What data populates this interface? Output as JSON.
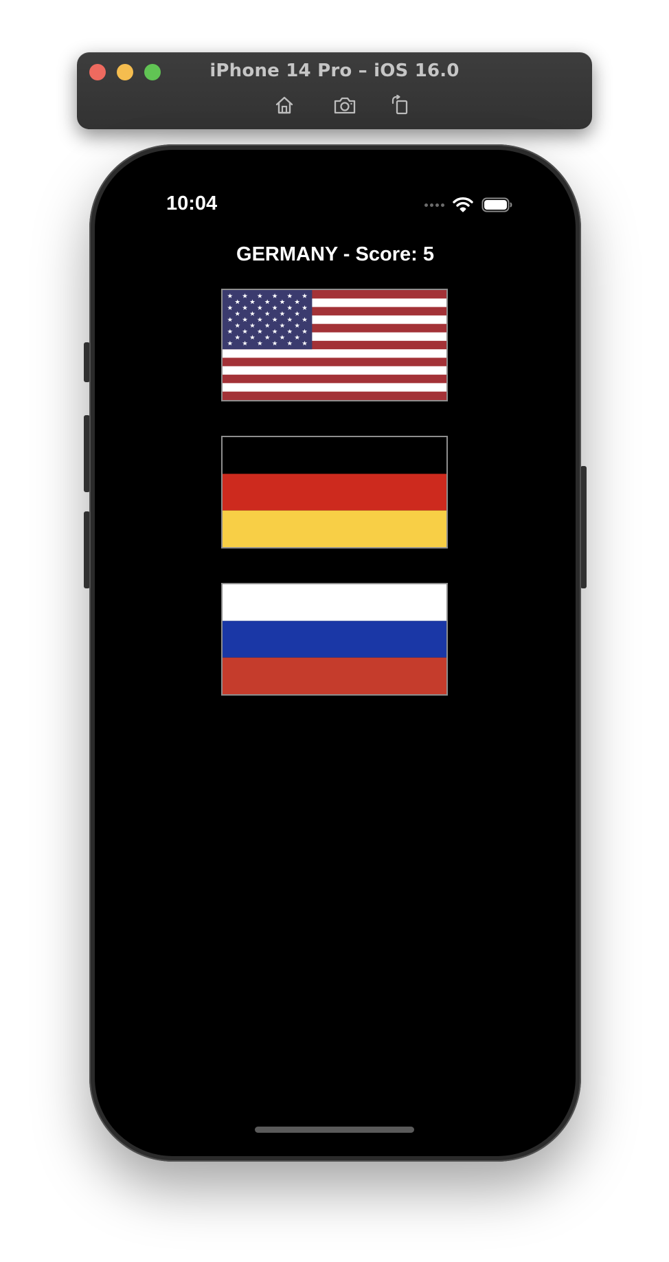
{
  "simulator": {
    "title": "iPhone 14 Pro – iOS 16.0",
    "toolbar": [
      {
        "icon": "home-icon"
      },
      {
        "icon": "screenshot-camera-icon"
      },
      {
        "icon": "rotate-icon"
      }
    ]
  },
  "status_bar": {
    "time": "10:04",
    "icons": [
      "cellular-signal-icon",
      "wifi-icon",
      "battery-icon"
    ]
  },
  "game": {
    "prompt": "GERMANY - Score: 5",
    "flags": [
      {
        "country": "United States",
        "icon": "us-flag-icon"
      },
      {
        "country": "Germany",
        "icon": "germany-flag-icon",
        "colors": [
          "#000000",
          "#cd2a1e",
          "#f8cf46"
        ]
      },
      {
        "country": "Russia",
        "icon": "russia-flag-icon",
        "colors": [
          "#ffffff",
          "#1a37a6",
          "#c53c2c"
        ]
      }
    ]
  },
  "colors": {
    "us_red": "#a33237",
    "us_blue": "#3b3b6e",
    "window_bar": "#383838",
    "screen_bg": "#000000"
  }
}
